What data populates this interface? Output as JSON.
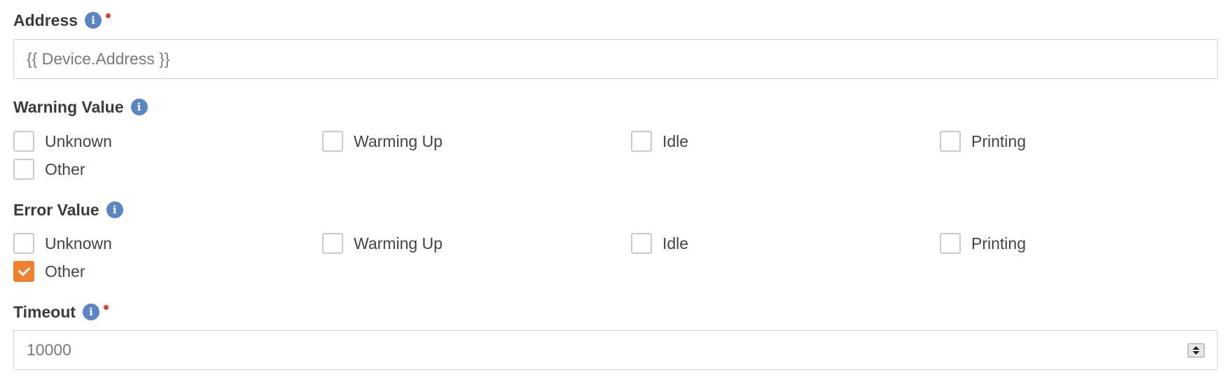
{
  "colors": {
    "info_icon": "#5b86c5",
    "required_dot": "#d9452b",
    "checkbox_checked": "#f07f2e",
    "input_border": "#cfcfcf"
  },
  "address": {
    "label": "Address",
    "required": true,
    "value": "{{ Device.Address }}"
  },
  "warning": {
    "label": "Warning Value",
    "options": [
      {
        "label": "Unknown",
        "checked": false
      },
      {
        "label": "Warming Up",
        "checked": false
      },
      {
        "label": "Idle",
        "checked": false
      },
      {
        "label": "Printing",
        "checked": false
      },
      {
        "label": "Other",
        "checked": false
      }
    ]
  },
  "error": {
    "label": "Error Value",
    "options": [
      {
        "label": "Unknown",
        "checked": false
      },
      {
        "label": "Warming Up",
        "checked": false
      },
      {
        "label": "Idle",
        "checked": false
      },
      {
        "label": "Printing",
        "checked": false
      },
      {
        "label": "Other",
        "checked": true
      }
    ]
  },
  "timeout": {
    "label": "Timeout",
    "required": true,
    "value": "10000"
  }
}
